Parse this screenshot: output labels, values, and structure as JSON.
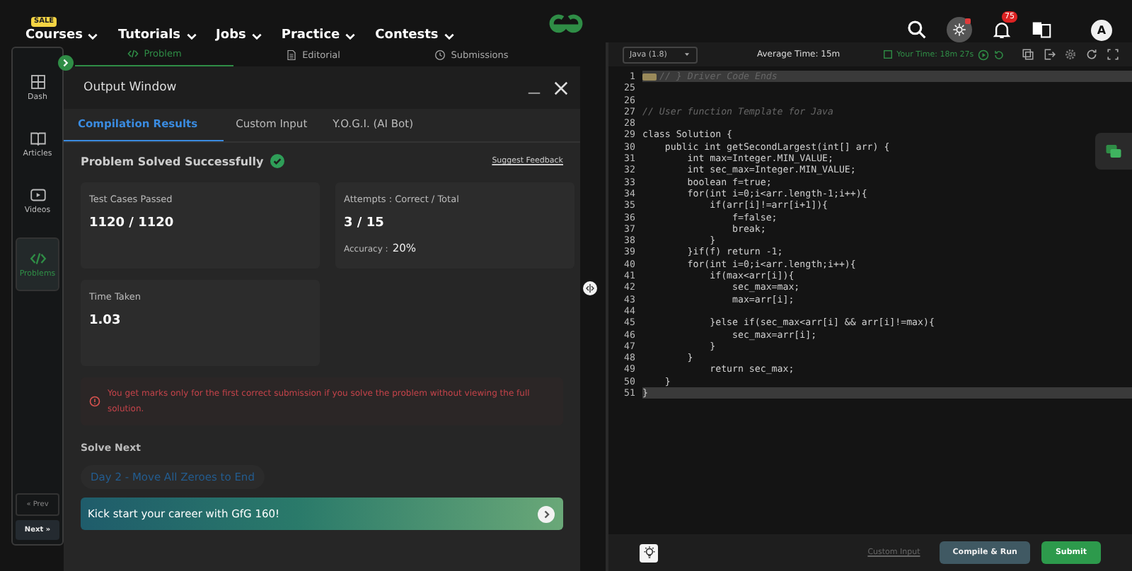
{
  "nav": {
    "items": [
      {
        "label": "Courses",
        "badge": "SALE"
      },
      {
        "label": "Tutorials"
      },
      {
        "label": "Jobs"
      },
      {
        "label": "Practice"
      },
      {
        "label": "Contests"
      }
    ],
    "notification_count": "75",
    "avatar": "A"
  },
  "sidebar": {
    "items": [
      {
        "label": "Dash",
        "selected": false
      },
      {
        "label": "Articles",
        "selected": false
      },
      {
        "label": "Videos",
        "selected": false
      },
      {
        "label": "Problems",
        "selected": true
      }
    ],
    "prev": "« Prev",
    "next": "Next »"
  },
  "problem_tabs": [
    {
      "label": "Problem",
      "selected": true
    },
    {
      "label": "Editorial",
      "selected": false
    },
    {
      "label": "Submissions",
      "selected": false
    }
  ],
  "output_window": {
    "title": "Output Window",
    "tabs": [
      {
        "label": "Compilation Results",
        "selected": true
      },
      {
        "label": "Custom Input",
        "selected": false
      },
      {
        "label": "Y.O.G.I. (AI Bot)",
        "selected": false
      }
    ],
    "status": "Problem Solved Successfully",
    "feedback_link": "Suggest Feedback",
    "cards": [
      {
        "label": "Test Cases Passed",
        "value": "1120 / 1120"
      },
      {
        "label": "Attempts : Correct / Total",
        "value": "3 / 15",
        "sub_label": "Accuracy :",
        "sub_value": "20%"
      },
      {
        "label": "Time Taken",
        "value": "1.03"
      }
    ],
    "warning": "You get marks only for the first correct submission if you solve the problem without viewing the full solution.",
    "solve_next_heading": "Solve Next",
    "solve_next": [
      "Day 2 - Move All Zeroes to End"
    ],
    "banner": "Kick start your career with GfG 160!"
  },
  "editor": {
    "language": "Java (1.8)",
    "average_time": "Average Time: 15m",
    "your_time": "Your Time: 18m 27s",
    "lines": [
      {
        "number": "1",
        "text": "// } Driver Code Ends",
        "kind": "folded",
        "highlighted": true
      },
      {
        "number": "25",
        "kind": "code",
        "highlighted": false
      },
      {
        "number": "26",
        "kind": "code",
        "highlighted": false
      },
      {
        "number": "27",
        "text": "// User function Template for Java",
        "kind": "comment",
        "highlighted": false
      },
      {
        "number": "28",
        "kind": "code",
        "highlighted": false
      },
      {
        "number": "29",
        "text": "class Solution {",
        "kind": "code",
        "highlighted": false
      },
      {
        "number": "30",
        "text": "    public int getSecondLargest(int[] arr) {",
        "kind": "code",
        "highlighted": false
      },
      {
        "number": "31",
        "text": "        int max=Integer.MIN_VALUE;",
        "kind": "code",
        "highlighted": false
      },
      {
        "number": "32",
        "text": "        int sec_max=Integer.MIN_VALUE;",
        "kind": "code",
        "highlighted": false
      },
      {
        "number": "33",
        "text": "        boolean f=true;",
        "kind": "code",
        "highlighted": false
      },
      {
        "number": "34",
        "text": "        for(int i=0;i<arr.length-1;i++){",
        "kind": "code",
        "highlighted": false
      },
      {
        "number": "35",
        "text": "            if(arr[i]!=arr[i+1]){",
        "kind": "code",
        "highlighted": false
      },
      {
        "number": "36",
        "text": "                f=false;",
        "kind": "code",
        "highlighted": false
      },
      {
        "number": "37",
        "text": "                break;",
        "kind": "code",
        "highlighted": false
      },
      {
        "number": "38",
        "text": "            }",
        "kind": "code",
        "highlighted": false
      },
      {
        "number": "39",
        "text": "        }if(f) return -1;",
        "kind": "code",
        "highlighted": false
      },
      {
        "number": "40",
        "text": "        for(int i=0;i<arr.length;i++){",
        "kind": "code",
        "highlighted": false
      },
      {
        "number": "41",
        "text": "            if(max<arr[i]){",
        "kind": "code",
        "highlighted": false
      },
      {
        "number": "42",
        "text": "                sec_max=max;",
        "kind": "code",
        "highlighted": false
      },
      {
        "number": "43",
        "text": "                max=arr[i];",
        "kind": "code",
        "highlighted": false
      },
      {
        "number": "44",
        "kind": "code",
        "highlighted": false
      },
      {
        "number": "45",
        "text": "            }else if(sec_max<arr[i] && arr[i]!=max){",
        "kind": "code",
        "highlighted": false
      },
      {
        "number": "46",
        "text": "                sec_max=arr[i];",
        "kind": "code",
        "highlighted": false
      },
      {
        "number": "47",
        "text": "            }",
        "kind": "code",
        "highlighted": false
      },
      {
        "number": "48",
        "text": "        }",
        "kind": "code",
        "highlighted": false
      },
      {
        "number": "49",
        "text": "            return sec_max;",
        "kind": "code",
        "highlighted": false
      },
      {
        "number": "50",
        "text": "    }",
        "kind": "code",
        "highlighted": false
      },
      {
        "number": "51",
        "text": "}",
        "kind": "code",
        "highlighted": true
      }
    ],
    "custom_input": "Custom Input",
    "compile_button": "Compile & Run",
    "submit_button": "Submit"
  }
}
